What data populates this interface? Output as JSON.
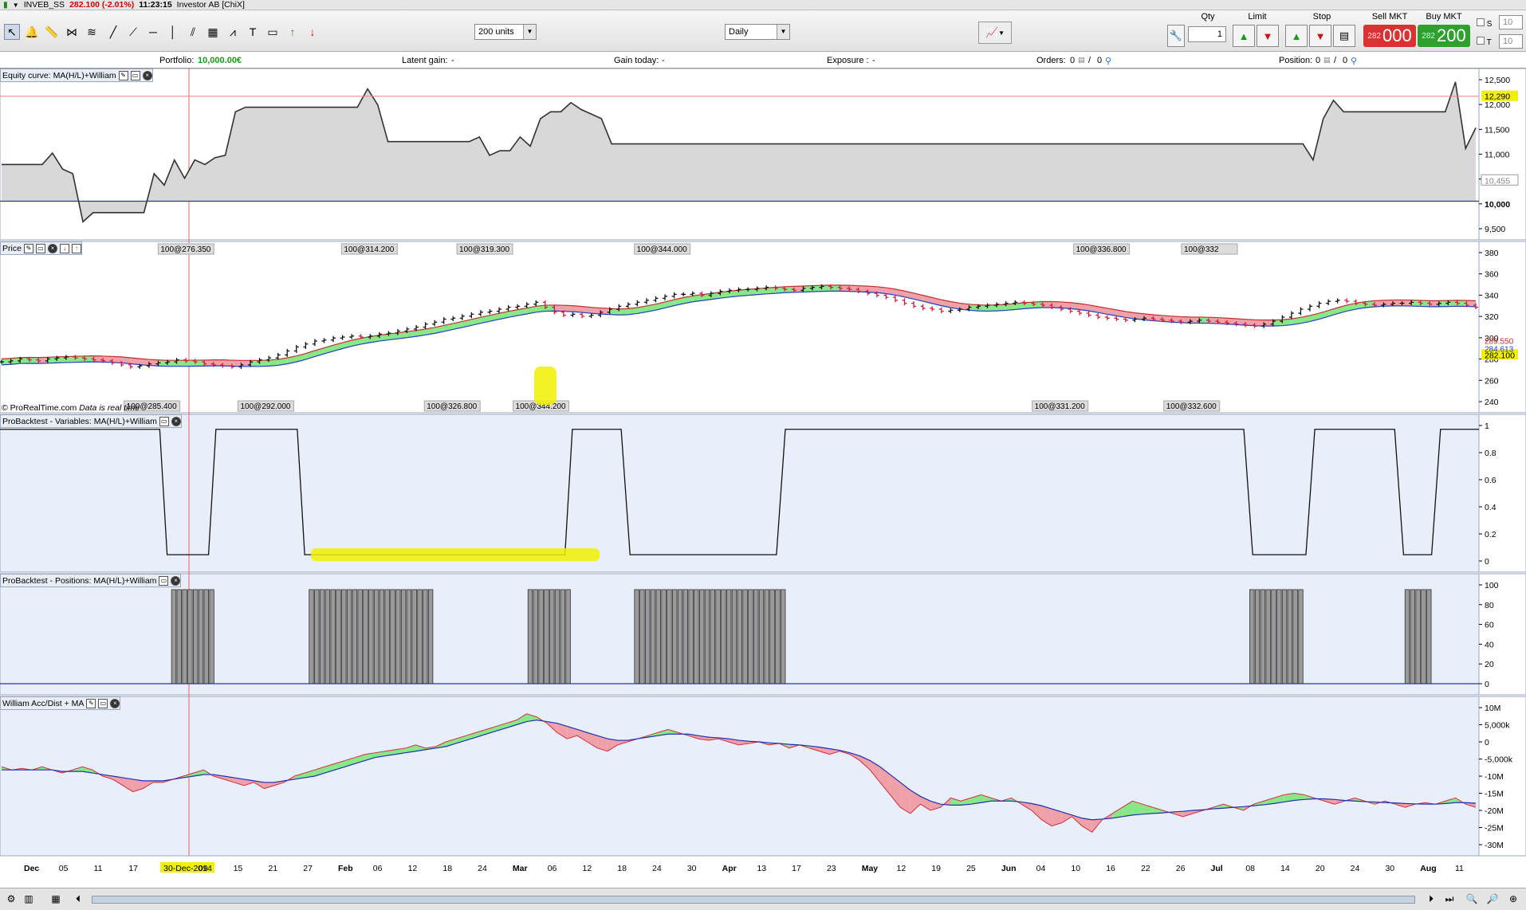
{
  "title_bar": {
    "symbol": "INVEB_SS",
    "price_change": "282.100 (-2.01%)",
    "time": "11:23:15",
    "instrument": "Investor AB [ChiX]"
  },
  "toolbar": {
    "units_value": "200 units",
    "period_value": "Daily",
    "qty_label": "Qty",
    "qty_value": "1",
    "limit_label": "Limit",
    "stop_label": "Stop",
    "sell_label": "Sell MKT",
    "sell_small": "282",
    "sell_big": "000",
    "buy_label": "Buy MKT",
    "buy_small": "282",
    "buy_big": "200",
    "s_label": "S",
    "s_value": "10",
    "t_label": "T",
    "t_value": "10",
    "colors": {
      "sell": "#d93232",
      "buy": "#2ea02e"
    }
  },
  "info_bar": {
    "portfolio_label": "Portfolio:",
    "portfolio_value": "10,000.00€",
    "latent_label": "Latent gain:",
    "latent_value": "-",
    "gain_label": "Gain today:",
    "gain_value": "-",
    "exposure_label": "Exposure :",
    "exposure_value": "-",
    "orders_label": "Orders:",
    "orders_value": "0",
    "orders_value2": "0",
    "position_label": "Position:",
    "position_value": "0",
    "position_value2": "0"
  },
  "panels": {
    "equity": {
      "title": "Equity curve: MA(H/L)+William"
    },
    "price": {
      "title": "Price",
      "copyright": "© ProRealTime.com",
      "realtime": "Data is real time"
    },
    "variables": {
      "title": "ProBacktest - Variables: MA(H/L)+William"
    },
    "positions": {
      "title": "ProBacktest - Positions: MA(H/L)+William"
    },
    "william": {
      "title": "William Acc/Dist + MA"
    }
  },
  "chart_data": [
    {
      "type": "area",
      "name": "equity",
      "y_ticks": [
        "12,500",
        "12,000",
        "11,500",
        "11,000",
        "10,500",
        "10,000",
        "9,500"
      ],
      "ylim": [
        9400,
        12650
      ],
      "current_value": "12,290",
      "marker_value": "10,455",
      "baseline": 10000,
      "values": [
        10800,
        10800,
        10800,
        10800,
        10800,
        11050,
        10700,
        10600,
        9550,
        9750,
        9750,
        9750,
        9750,
        9750,
        9750,
        10600,
        10350,
        10900,
        10500,
        10900,
        10800,
        10950,
        11000,
        11950,
        12050,
        12050,
        12050,
        12050,
        12050,
        12050,
        12050,
        12050,
        12050,
        12050,
        12050,
        12050,
        12450,
        12100,
        11300,
        11300,
        11300,
        11300,
        11300,
        11300,
        11300,
        11300,
        11300,
        11400,
        11000,
        11100,
        11100,
        11400,
        11200,
        11800,
        11950,
        11950,
        12150,
        12000,
        11900,
        11800,
        11250,
        11250,
        11250,
        11250,
        11250,
        11250,
        11250,
        11250,
        11250,
        11250,
        11250,
        11250,
        11250,
        11250,
        11250,
        11250,
        11250,
        11250,
        11250,
        11250,
        11250,
        11250,
        11250,
        11250,
        11250,
        11250,
        11250,
        11250,
        11250,
        11250,
        11250,
        11250,
        11250,
        11250,
        11250,
        11250,
        11250,
        11250,
        11250,
        11250,
        11250,
        11250,
        11250,
        11250,
        11250,
        11250,
        11250,
        11250,
        11250,
        11250,
        11250,
        11250,
        11250,
        11250,
        11250,
        11250,
        11250,
        11250,
        11250,
        11250,
        11250,
        11250,
        11250,
        11250,
        11250,
        11250,
        11250,
        11250,
        11250,
        10900,
        11800,
        12200,
        11950,
        11950,
        11950,
        11950,
        11950,
        11950,
        11950,
        11950,
        11950,
        11950,
        11950,
        12600,
        11150,
        11600
      ]
    },
    {
      "type": "candlestick",
      "name": "price",
      "y_ticks": [
        "380",
        "360",
        "340",
        "320",
        "300",
        "280",
        "260",
        "240"
      ],
      "ylim": [
        235,
        385
      ],
      "last_price": "282.100",
      "ma_high": "289.550",
      "ma_low": "284.613",
      "trade_labels_top": [
        "100@276.350",
        "100@314.200",
        "100@319.300",
        "100@344.000",
        "100@336.800",
        "100@332"
      ],
      "trade_labels_bottom": [
        "100@285.400",
        "100@292.000",
        "100@326.800",
        "100@344.200",
        "100@331.200",
        "100@332.600"
      ],
      "closes": [
        275,
        276,
        278,
        277,
        276,
        278,
        279,
        280,
        279,
        278,
        277,
        276,
        274,
        272,
        270,
        271,
        273,
        274,
        275,
        277,
        276,
        275,
        273,
        272,
        271,
        270,
        272,
        275,
        277,
        279,
        282,
        286,
        290,
        293,
        296,
        297,
        299,
        300,
        301,
        300,
        301,
        303,
        304,
        306,
        308,
        310,
        313,
        315,
        318,
        319,
        321,
        323,
        325,
        326,
        328,
        330,
        331,
        333,
        335,
        330,
        325,
        322,
        323,
        321,
        322,
        325,
        328,
        331,
        333,
        335,
        337,
        339,
        341,
        343,
        343,
        344,
        342,
        344,
        346,
        347,
        348,
        348,
        349,
        350,
        349,
        348,
        347,
        349,
        350,
        351,
        350,
        349,
        348,
        346,
        344,
        342,
        340,
        337,
        334,
        331,
        329,
        328,
        326,
        327,
        328,
        330,
        331,
        332,
        333,
        334,
        335,
        334,
        333,
        332,
        330,
        328,
        326,
        324,
        322,
        320,
        319,
        318,
        317,
        318,
        319,
        318,
        317,
        316,
        315,
        316,
        317,
        316,
        315,
        314,
        313,
        312,
        311,
        313,
        316,
        320,
        324,
        328,
        331,
        334,
        336,
        337,
        336,
        334,
        333,
        332,
        333,
        334,
        334,
        335,
        334,
        333,
        334,
        335,
        334,
        332,
        330
      ]
    },
    {
      "type": "line",
      "name": "variables",
      "y_ticks": [
        "1",
        "0.8",
        "0.6",
        "0.4",
        "0.2",
        "0"
      ],
      "ylim": [
        -0.05,
        1.03
      ],
      "segments": [
        [
          0,
          1
        ],
        [
          0.108,
          1
        ],
        [
          0.113,
          0
        ],
        [
          0.141,
          0
        ],
        [
          0.146,
          1
        ],
        [
          0.201,
          1
        ],
        [
          0.206,
          0
        ],
        [
          0.382,
          0
        ],
        [
          0.387,
          1
        ],
        [
          0.42,
          1
        ],
        [
          0.426,
          0
        ],
        [
          0.525,
          0
        ],
        [
          0.531,
          1
        ],
        [
          0.841,
          1
        ],
        [
          0.847,
          0
        ],
        [
          0.883,
          0
        ],
        [
          0.889,
          1
        ],
        [
          0.943,
          1
        ],
        [
          0.949,
          0
        ],
        [
          0.968,
          0
        ],
        [
          0.974,
          1
        ],
        [
          1,
          1
        ]
      ]
    },
    {
      "type": "bar",
      "name": "positions",
      "y_ticks": [
        "100",
        "80",
        "60",
        "40",
        "20",
        "0"
      ],
      "ylim": [
        0,
        105
      ],
      "blocks": [
        [
          0.116,
          0.144
        ],
        [
          0.209,
          0.293
        ],
        [
          0.357,
          0.385
        ],
        [
          0.429,
          0.529
        ],
        [
          0.845,
          0.879
        ],
        [
          0.95,
          0.968
        ]
      ]
    },
    {
      "type": "area",
      "name": "william",
      "y_ticks": [
        "10M",
        "5,000k",
        "0",
        "-5,000k",
        "-10M",
        "-15M",
        "-20M",
        "-25M",
        "-30M"
      ],
      "ylim": [
        -32,
        12
      ],
      "values": [
        -7,
        -8,
        -7.5,
        -8,
        -7,
        -8,
        -9,
        -8,
        -7,
        -8,
        -10,
        -11,
        -13,
        -15,
        -14,
        -12,
        -12,
        -11,
        -10,
        -9,
        -8,
        -10,
        -11,
        -12,
        -13,
        -12,
        -14,
        -13,
        -12,
        -10,
        -9,
        -8,
        -7,
        -6,
        -5,
        -4,
        -3,
        -2.5,
        -2,
        -1.5,
        -1,
        0,
        -1,
        -0.5,
        1,
        2,
        3,
        4,
        5,
        6,
        7,
        8,
        10,
        9,
        7,
        4,
        2,
        3,
        1,
        -1,
        -2,
        0,
        1,
        2,
        3,
        4,
        5,
        4,
        3,
        2,
        1.5,
        2,
        1,
        0,
        0.5,
        1,
        0,
        0.5,
        -1,
        0,
        -1,
        -2,
        -3,
        -2,
        -3,
        -5,
        -8,
        -12,
        -16,
        -20,
        -22,
        -19,
        -21,
        -20,
        -17,
        -18,
        -17,
        -16,
        -17,
        -18,
        -17,
        -19,
        -21,
        -24,
        -26,
        -25,
        -23,
        -26,
        -28,
        -24,
        -22,
        -20,
        -18,
        -19,
        -20,
        -21,
        -22,
        -23,
        -22,
        -21,
        -20,
        -19,
        -20,
        -21,
        -19,
        -18,
        -17,
        -16,
        -15.5,
        -16,
        -17,
        -18,
        -19,
        -18,
        -17,
        -18,
        -19,
        -18,
        -19,
        -20,
        -19,
        -18.5,
        -19,
        -18,
        -17,
        -19,
        -20
      ],
      "ma_values": [
        -8,
        -8,
        -8,
        -8,
        -8,
        -8,
        -8.5,
        -8.5,
        -8.5,
        -9,
        -9.5,
        -10,
        -10.5,
        -11,
        -11.5,
        -11.5,
        -11.5,
        -11,
        -10.5,
        -10,
        -9.5,
        -9.5,
        -10,
        -10.5,
        -11,
        -11.5,
        -12,
        -12,
        -11.5,
        -11,
        -10.5,
        -10,
        -9,
        -8,
        -7,
        -6,
        -5,
        -4,
        -3.5,
        -3,
        -2.5,
        -2,
        -1.5,
        -1,
        -0.5,
        0.5,
        1.5,
        2.5,
        3.5,
        4.5,
        5.5,
        6.5,
        7.5,
        8,
        7.5,
        7,
        6,
        5,
        4,
        3,
        2,
        1.5,
        1.5,
        2,
        2.5,
        3,
        3.5,
        3.5,
        3.5,
        3,
        2.5,
        2.3,
        2,
        1.5,
        1.2,
        1,
        0.7,
        0.5,
        0.2,
        0,
        -0.3,
        -0.7,
        -1.2,
        -1.7,
        -2.5,
        -3.5,
        -5,
        -7,
        -9.5,
        -12,
        -14.5,
        -16.5,
        -18,
        -19,
        -19.3,
        -19.3,
        -19,
        -18.5,
        -18,
        -18,
        -18,
        -18.3,
        -18.8,
        -19.5,
        -20.5,
        -21.5,
        -22.5,
        -23.5,
        -24,
        -23.8,
        -23.5,
        -23,
        -22.5,
        -22.2,
        -22,
        -21.8,
        -21.5,
        -21.3,
        -21,
        -20.8,
        -20.5,
        -20.3,
        -20,
        -19.8,
        -19.5,
        -19.2,
        -18.8,
        -18.3,
        -17.8,
        -17.5,
        -17.3,
        -17.3,
        -17.5,
        -17.8,
        -18,
        -18.2,
        -18.3,
        -18.5,
        -18.6,
        -18.8,
        -18.9,
        -19,
        -19,
        -18.8,
        -18.5,
        -18.5,
        -18.7
      ]
    }
  ],
  "x_axis": {
    "labels": [
      {
        "t": "Dec",
        "m": true
      },
      {
        "t": "05"
      },
      {
        "t": "11"
      },
      {
        "t": "17"
      },
      {
        "t": "30-Dec-2014",
        "hl": true
      },
      {
        "t": "09"
      },
      {
        "t": "15"
      },
      {
        "t": "21"
      },
      {
        "t": "27"
      },
      {
        "t": "Feb",
        "m": true
      },
      {
        "t": "06"
      },
      {
        "t": "12"
      },
      {
        "t": "18"
      },
      {
        "t": "24"
      },
      {
        "t": "Mar",
        "m": true
      },
      {
        "t": "06"
      },
      {
        "t": "12"
      },
      {
        "t": "18"
      },
      {
        "t": "24"
      },
      {
        "t": "30"
      },
      {
        "t": "Apr",
        "m": true
      },
      {
        "t": "13"
      },
      {
        "t": "17"
      },
      {
        "t": "23"
      },
      {
        "t": "May",
        "m": true
      },
      {
        "t": "12"
      },
      {
        "t": "19"
      },
      {
        "t": "25"
      },
      {
        "t": "Jun",
        "m": true
      },
      {
        "t": "04"
      },
      {
        "t": "10"
      },
      {
        "t": "16"
      },
      {
        "t": "22"
      },
      {
        "t": "26"
      },
      {
        "t": "Jul",
        "m": true
      },
      {
        "t": "08"
      },
      {
        "t": "14"
      },
      {
        "t": "20"
      },
      {
        "t": "24"
      },
      {
        "t": "30"
      },
      {
        "t": "Aug",
        "m": true
      },
      {
        "t": "11"
      }
    ]
  },
  "colors": {
    "highlight": "#f0f000",
    "up": "#d41a3c",
    "down": "#111111",
    "ma_fill_up": "#88e888",
    "ma_fill_down": "#f0a0a8",
    "panel_bg": "#e8eefa"
  }
}
